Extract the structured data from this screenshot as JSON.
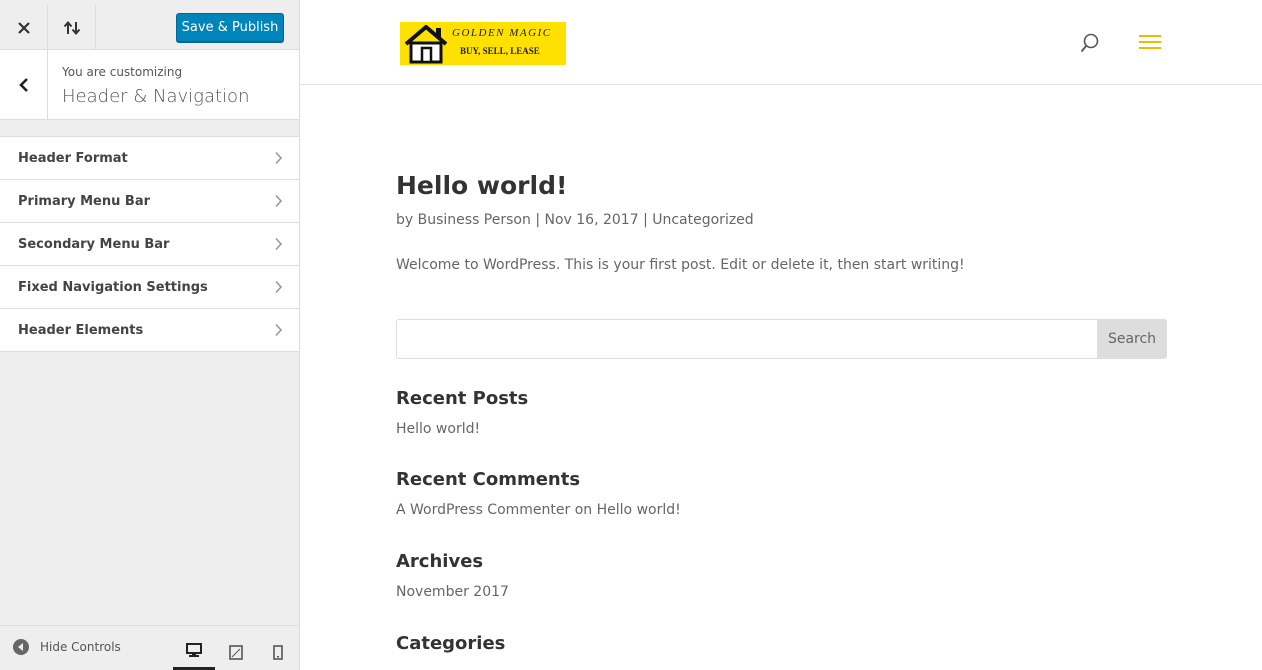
{
  "customizer": {
    "topbar": {
      "close_icon": "close-icon",
      "reorder_icon": "reorder-arrows-icon",
      "publish_label": "Save & Publish"
    },
    "section": {
      "customizing_label": "You are customizing",
      "title": "Header & Navigation"
    },
    "menu_items": [
      {
        "label": "Header Format"
      },
      {
        "label": "Primary Menu Bar"
      },
      {
        "label": "Secondary Menu Bar"
      },
      {
        "label": "Fixed Navigation Settings"
      },
      {
        "label": "Header Elements"
      }
    ],
    "footer": {
      "hide_controls_label": "Hide Controls",
      "devices": [
        "desktop",
        "tablet",
        "mobile"
      ],
      "active_device": "desktop"
    }
  },
  "preview": {
    "logo": {
      "brand": "GOLDEN MAGIC",
      "tagline": "BUY, SELL, LEASE",
      "background": "#ffe100"
    },
    "accent_color": "#f5b800",
    "post": {
      "title": "Hello world!",
      "meta_prefix": "by",
      "author": "Business Person",
      "separator": "|",
      "date": "Nov 16, 2017",
      "category": "Uncategorized",
      "body": "Welcome to WordPress. This is your first post. Edit or delete it, then start writing!"
    },
    "search": {
      "button_label": "Search",
      "value": ""
    },
    "widgets": {
      "recent_posts_title": "Recent Posts",
      "recent_posts": [
        "Hello world!"
      ],
      "recent_comments_title": "Recent Comments",
      "recent_comment_author": "A WordPress Commenter",
      "recent_comment_on": "on",
      "recent_comment_post": "Hello world!",
      "archives_title": "Archives",
      "archives": [
        "November 2017"
      ],
      "categories_title": "Categories"
    }
  }
}
